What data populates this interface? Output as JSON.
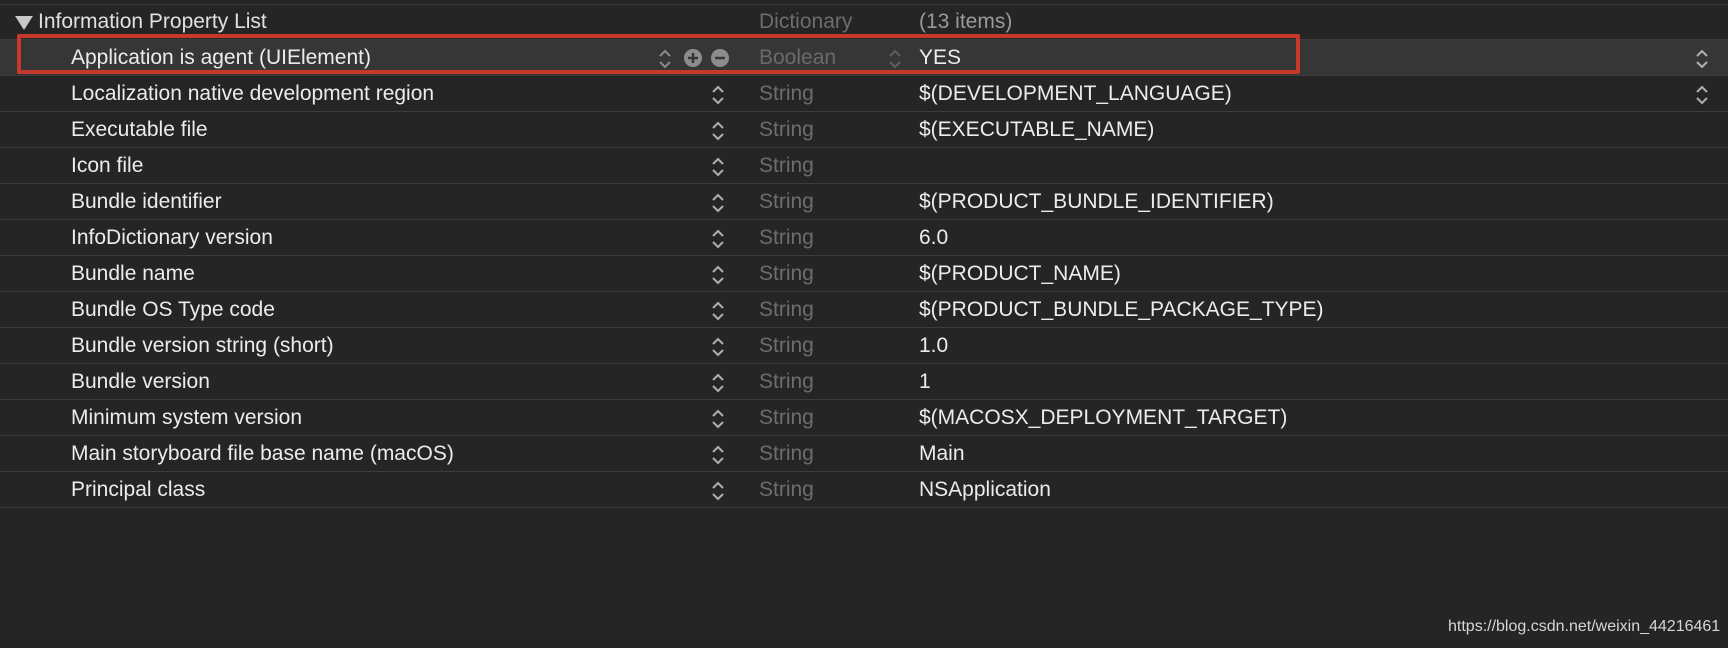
{
  "root": {
    "key": "Information Property List",
    "type": "Dictionary",
    "value": "(13 items)"
  },
  "rows": [
    {
      "key": "Application is agent (UIElement)",
      "type": "Boolean",
      "value": "YES"
    },
    {
      "key": "Localization native development region",
      "type": "String",
      "value": "$(DEVELOPMENT_LANGUAGE)"
    },
    {
      "key": "Executable file",
      "type": "String",
      "value": "$(EXECUTABLE_NAME)"
    },
    {
      "key": "Icon file",
      "type": "String",
      "value": ""
    },
    {
      "key": "Bundle identifier",
      "type": "String",
      "value": "$(PRODUCT_BUNDLE_IDENTIFIER)"
    },
    {
      "key": "InfoDictionary version",
      "type": "String",
      "value": "6.0"
    },
    {
      "key": "Bundle name",
      "type": "String",
      "value": "$(PRODUCT_NAME)"
    },
    {
      "key": "Bundle OS Type code",
      "type": "String",
      "value": "$(PRODUCT_BUNDLE_PACKAGE_TYPE)"
    },
    {
      "key": "Bundle version string (short)",
      "type": "String",
      "value": "1.0"
    },
    {
      "key": "Bundle version",
      "type": "String",
      "value": "1"
    },
    {
      "key": "Minimum system version",
      "type": "String",
      "value": "$(MACOSX_DEPLOYMENT_TARGET)"
    },
    {
      "key": "Main storyboard file base name (macOS)",
      "type": "String",
      "value": "Main"
    },
    {
      "key": "Principal class",
      "type": "String",
      "value": "NSApplication"
    }
  ],
  "watermark": "https://blog.csdn.net/weixin_44216461",
  "colors": {
    "background": "#252525",
    "selected_row": "#363636",
    "highlight_border": "#c8392d",
    "type_text": "#6d6d6d"
  },
  "icons": {
    "disclosure": "disclosure-triangle-icon",
    "stepper": "up-down-chevron-icon",
    "add": "plus-circle-icon",
    "remove": "minus-circle-icon"
  }
}
